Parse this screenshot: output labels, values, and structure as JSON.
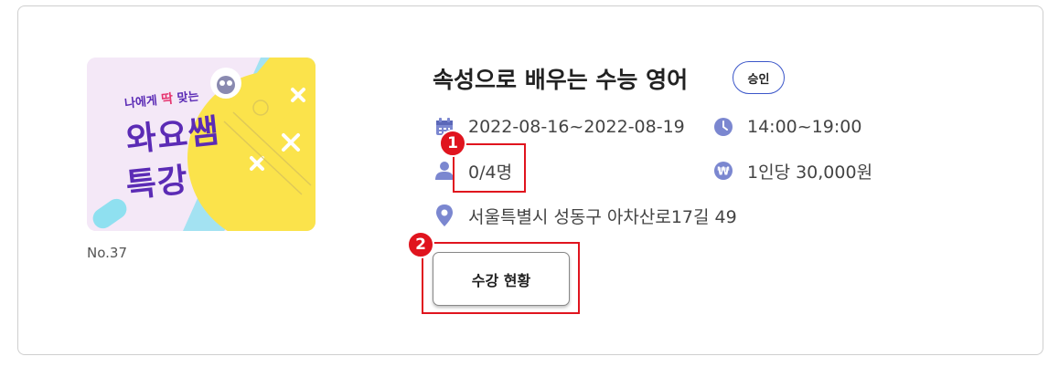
{
  "course": {
    "title": "속성으로 배우는 수능 영어",
    "status_badge": "승인",
    "number": "No.37",
    "thumbnail": {
      "line_small_prefix": "나에게 ",
      "line_small_emph": "딱",
      "line_small_suffix": " 맞는",
      "line_big_1": "와요쌤",
      "line_big_2": "특강"
    },
    "date_range": "2022-08-16~2022-08-19",
    "time_range": "14:00~19:00",
    "capacity": "0/4명",
    "price": "1인당 30,000원",
    "location": "서울특별시 성동구 아차산로17길 49",
    "action_button": "수강 현황"
  },
  "annotations": {
    "marker_1": "1",
    "marker_2": "2"
  },
  "icons": {
    "date": "calendar-icon",
    "time": "clock-icon",
    "capacity": "person-icon",
    "price": "won-coin-icon",
    "location": "map-pin-icon"
  },
  "colors": {
    "icon": "#7b87d0",
    "badge_border": "#3b56c9",
    "highlight": "#e0141e",
    "thumb_purple": "#5b2bb5",
    "thumb_yellow": "#fbe34b"
  }
}
